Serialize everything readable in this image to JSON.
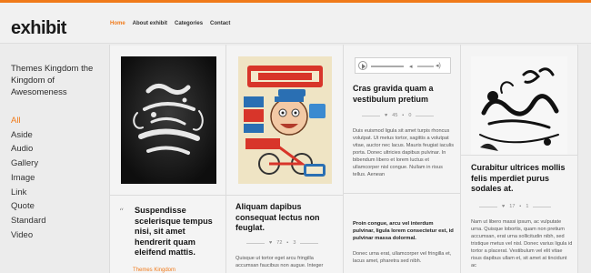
{
  "header": {
    "logo": "exhibit",
    "nav": [
      "Home",
      "About exhibit",
      "Categories",
      "Contact"
    ]
  },
  "sidebar": {
    "tagline": "Themes Kingdom the Kingdom of Awesomeness",
    "formats": [
      "All",
      "Aside",
      "Audio",
      "Gallery",
      "Image",
      "Link",
      "Quote",
      "Standard",
      "Video"
    ]
  },
  "posts": {
    "quote": {
      "text": "Suspendisse scelerisque tempus nisi, sit amet hendrerit quam eleifend mattis.",
      "author": "Themes Kingdom"
    },
    "monster": {
      "title": "Aliquam dapibus consequat lectus non feuglat.",
      "likes": "72",
      "comments": "3",
      "excerpt": "Quisque ut tortor eget arcu fringilla accumsan faucibus non augue. Integer"
    },
    "audio": {
      "title": "Cras gravida quam a vestibulum pretium",
      "likes": "45",
      "comments": "0",
      "excerpt": "Duis euismod ligula sit amet turpis rhoncus volutpat. Ut metus tortor, sagittis a volutpat vitae, auctor nec lacus. Mauris feugiat iaculis porta. Donec ultricies dapibus pulvinar. In bibendum libero et lorem luctus et ullamcorper nisl congue. Nullam in risus tellus. Aenean"
    },
    "aside": {
      "text": "Proin congue, arcu vel interdum pulvinar, ligula lorem consectetur est, id pulvinar massa dolormal.",
      "excerpt": "Donec urna erat, ullamcorper vel fringilla et, lacus amet, pharetra sed nibh."
    },
    "chapter": {
      "title": "Curabitur ultrices mollis felis mperdiet purus sodales at.",
      "likes": "17",
      "comments": "1",
      "excerpt": "Nam ut libero massi ipsum, ac vulputate urna. Quisque lobortis, quam non pretium accumsan, erat urna sollicitudin nibh, sed tristique metus vel nisl. Donec varius ligula id tortor a placerat. Vestibulum vel elit vitae risus dapibus ullam et, sit amet at tincidunt ac"
    }
  }
}
